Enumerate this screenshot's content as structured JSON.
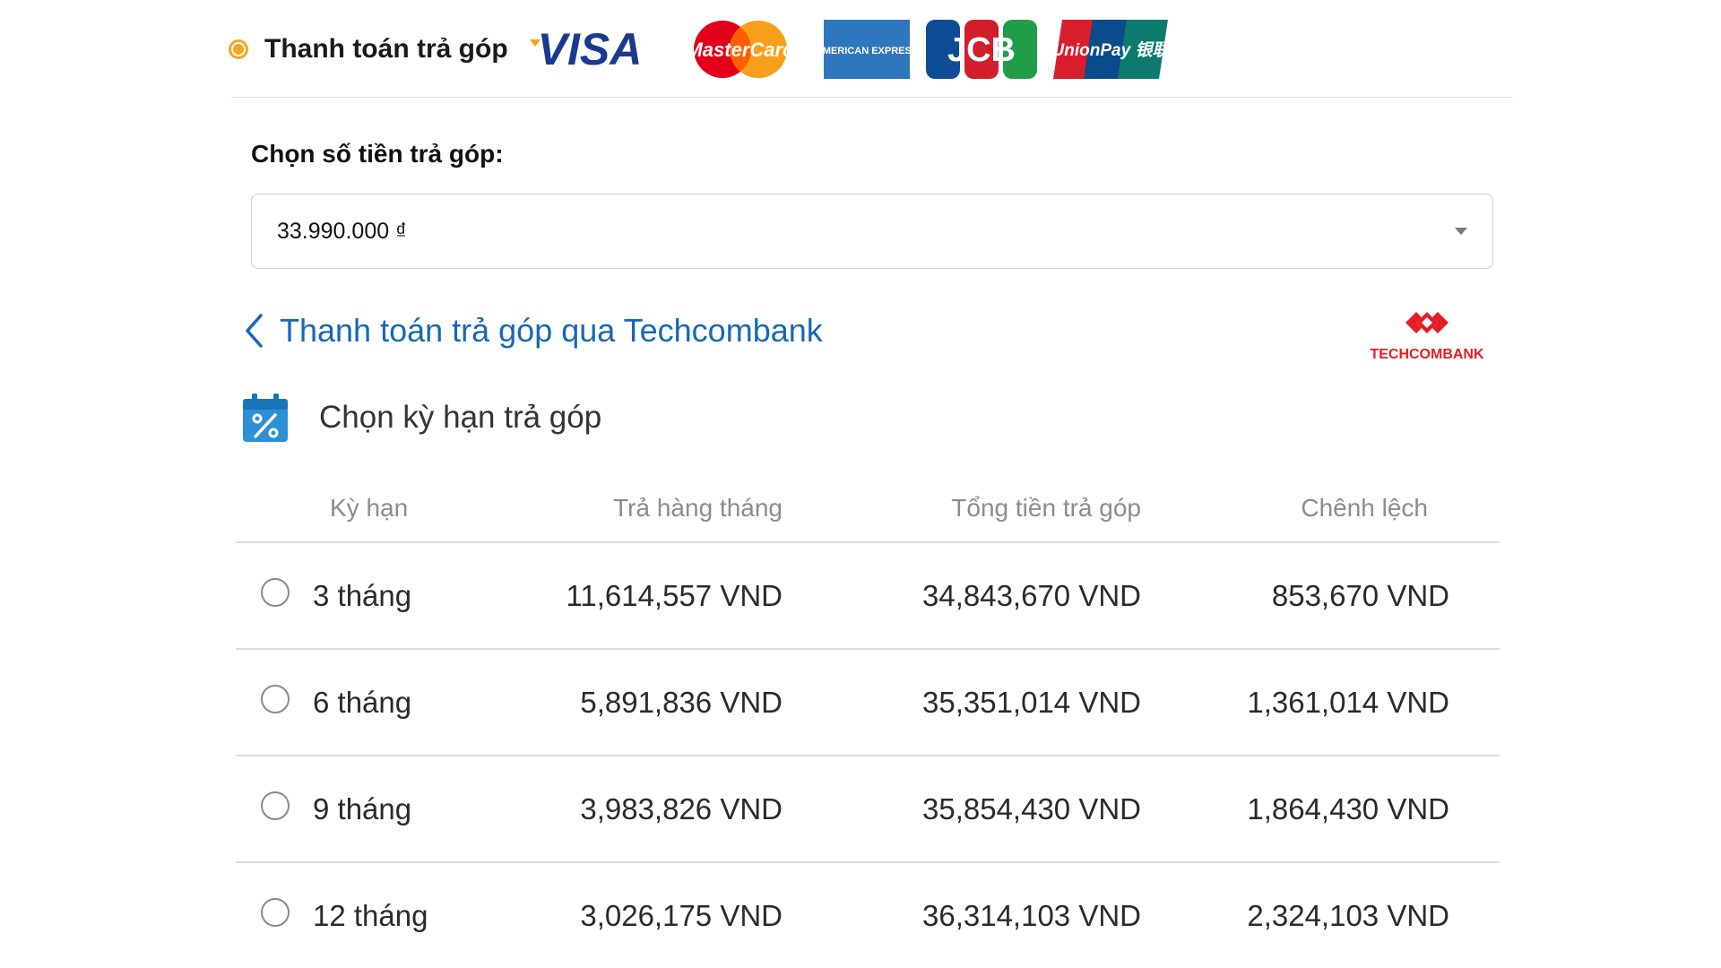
{
  "payment": {
    "label": "Thanh toán trả góp",
    "cards": [
      "VISA",
      "MasterCard",
      "AMERICAN EXPRESS",
      "JCB",
      "UnionPay 银联"
    ]
  },
  "amount": {
    "label": "Chọn số tiền trả góp:",
    "selected": "33.990.000 ₫"
  },
  "bank": {
    "title": "Thanh toán trả góp qua Techcombank",
    "logo_text": "TECHCOMBANK"
  },
  "term": {
    "title": "Chọn kỳ hạn trả góp"
  },
  "table": {
    "headers": [
      "Kỳ hạn",
      "Trả hàng tháng",
      "Tổng tiền trả góp",
      "Chênh lệch"
    ],
    "rows": [
      {
        "term": "3 tháng",
        "monthly": "11,614,557 VND",
        "total": "34,843,670 VND",
        "diff": "853,670 VND"
      },
      {
        "term": "6 tháng",
        "monthly": "5,891,836 VND",
        "total": "35,351,014 VND",
        "diff": "1,361,014 VND"
      },
      {
        "term": "9 tháng",
        "monthly": "3,983,826 VND",
        "total": "35,854,430 VND",
        "diff": "1,864,430 VND"
      },
      {
        "term": "12 tháng",
        "monthly": "3,026,175 VND",
        "total": "36,314,103 VND",
        "diff": "2,324,103 VND"
      }
    ]
  },
  "colors": {
    "accent": "#f5a623",
    "link": "#1668b8",
    "techcombank_red": "#e31e26"
  }
}
